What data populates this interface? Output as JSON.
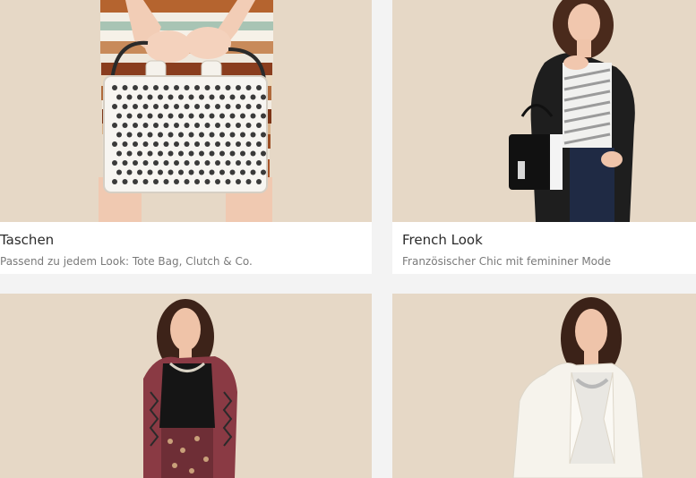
{
  "cards": [
    {
      "title": "Taschen",
      "subtitle": "Passend zu jedem Look: Tote Bag, Clutch & Co."
    },
    {
      "title": "French Look",
      "subtitle": "Französischer Chic mit femininer Mode"
    },
    {
      "title": "",
      "subtitle": ""
    },
    {
      "title": "",
      "subtitle": ""
    }
  ],
  "colors": {
    "page_background": "#f3f3f3",
    "card_background": "#ffffff",
    "photo_background": "#e6d8c6",
    "title_text": "#2b2b2b",
    "subtitle_text": "#7a7a7a"
  }
}
